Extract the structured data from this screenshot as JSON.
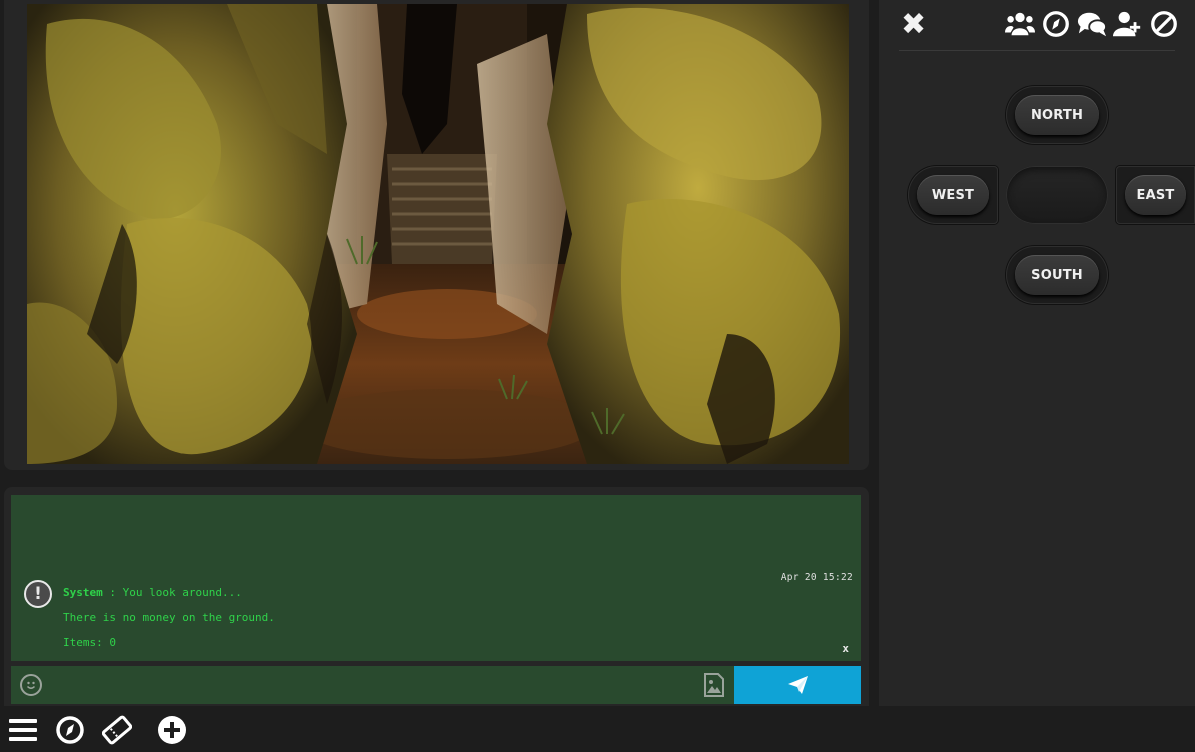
{
  "scene": {
    "image_name": "mossy-canyon-passage-with-stairs"
  },
  "chat": {
    "timestamp": "Apr 20 15:22",
    "sender": "System",
    "separator": " : ",
    "message": "You look around...",
    "line2": "There is no money on the ground.",
    "line3": "Items: 0",
    "dismiss": "x",
    "input_value": "",
    "colors": {
      "log_bg": "#294a2e",
      "text": "#2fd24a",
      "send": "#0fa3d6"
    }
  },
  "side": {
    "close_label": "✖",
    "icons": [
      "users-icon",
      "compass-icon",
      "chat-bubbles-icon",
      "add-user-icon",
      "block-icon"
    ]
  },
  "directions": {
    "north": "NORTH",
    "south": "SOUTH",
    "west": "WEST",
    "east": "EAST"
  },
  "bottom_bar": {
    "icons": [
      "menu-icon",
      "compass-icon",
      "ticket-icon",
      "add-circle-icon"
    ]
  }
}
